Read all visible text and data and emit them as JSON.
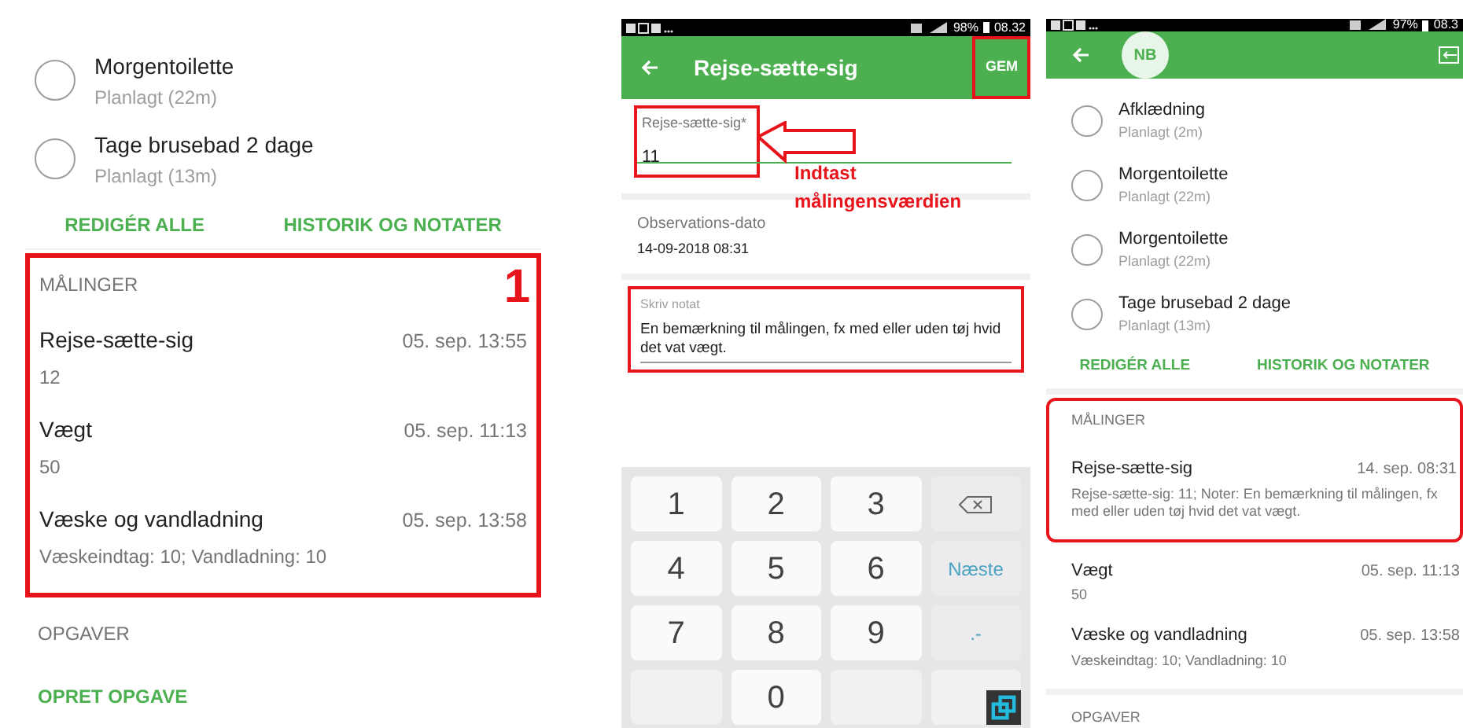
{
  "overview": {
    "tasks": [
      {
        "title": "Morgentoilette",
        "status": "Planlagt (22m)",
        "checked": false
      },
      {
        "title": "Tage brusebad 2 dage",
        "status": "Planlagt (13m)",
        "checked": false
      }
    ],
    "actions": [
      "REDIGÉR ALLE",
      "HISTORIK OG NOTATER"
    ],
    "measurements": {
      "heading": "MÅLINGER",
      "annotation_number": "1",
      "items": [
        {
          "name": "Rejse-sætte-sig",
          "date": "05. sep. 13:55",
          "value": "12",
          "annotated": true
        },
        {
          "name": "Vægt",
          "date": "05. sep. 11:13",
          "value": "50",
          "annotated": true
        },
        {
          "name": "Væske og vandladning",
          "date": "05. sep. 13:58",
          "value": "Væskeindtag: 10; Vandladning: 10",
          "annotated": true
        }
      ]
    },
    "tasks_heading": "OPGAVER",
    "create_task": "OPRET OPGAVE"
  },
  "edit_form": {
    "status_bar": {
      "battery": "98%",
      "time": "08.32"
    },
    "title": "Rejse-sætte-sig",
    "save": "GEM",
    "value_field": {
      "label": "Rejse-sætte-sig*",
      "value": "11"
    },
    "annotation": "Indtast målingensværdien",
    "date_field": {
      "label": "Observations-dato",
      "value": "14-09-2018 08:31"
    },
    "note_field": {
      "label": "Skriv notat",
      "value": "En bemærkning til målingen, fx med eller uden tøj hvid det vat vægt."
    },
    "keyboard": [
      {
        "label": "1",
        "kind": "digit"
      },
      {
        "label": "2",
        "kind": "digit"
      },
      {
        "label": "3",
        "kind": "digit"
      },
      {
        "kind": "backspace"
      },
      {
        "label": "4",
        "kind": "digit"
      },
      {
        "label": "5",
        "kind": "digit"
      },
      {
        "label": "6",
        "kind": "digit"
      },
      {
        "label": "Næste",
        "kind": "action"
      },
      {
        "label": "7",
        "kind": "digit"
      },
      {
        "label": "8",
        "kind": "digit"
      },
      {
        "label": "9",
        "kind": "digit"
      },
      {
        "label": ".-",
        "kind": "action"
      },
      {
        "kind": "blank"
      },
      {
        "label": "0",
        "kind": "digit"
      },
      {
        "kind": "blank"
      },
      {
        "kind": "blank"
      }
    ]
  },
  "updated_overview": {
    "status_bar": {
      "battery": "97%",
      "time": "08.3"
    },
    "avatar": "NB",
    "tasks": [
      {
        "title": "Afklædning",
        "status": "Planlagt (2m)",
        "checked": false
      },
      {
        "title": "Morgentoilette",
        "status": "Planlagt (22m)",
        "checked": false
      },
      {
        "title": "Morgentoilette",
        "status": "Planlagt (22m)",
        "checked": false
      },
      {
        "title": "Tage brusebad 2 dage",
        "status": "Planlagt (13m)",
        "checked": false
      }
    ],
    "actions": [
      "REDIGÉR ALLE",
      "HISTORIK OG NOTATER"
    ],
    "measurements": {
      "heading": "MÅLINGER",
      "items": [
        {
          "name": "Rejse-sætte-sig",
          "date": "14. sep. 08:31",
          "value": "Rejse-sætte-sig: 11; Noter: En bemærkning til målingen, fx med eller uden tøj hvid det vat vægt.",
          "annotated": true
        },
        {
          "name": "Vægt",
          "date": "05. sep. 11:13",
          "value": "50",
          "annotated": false
        },
        {
          "name": "Væske og vandladning",
          "date": "05. sep. 13:58",
          "value": "Væskeindtag: 10; Vandladning: 10",
          "annotated": false
        }
      ]
    },
    "tasks_heading": "OPGAVER"
  }
}
